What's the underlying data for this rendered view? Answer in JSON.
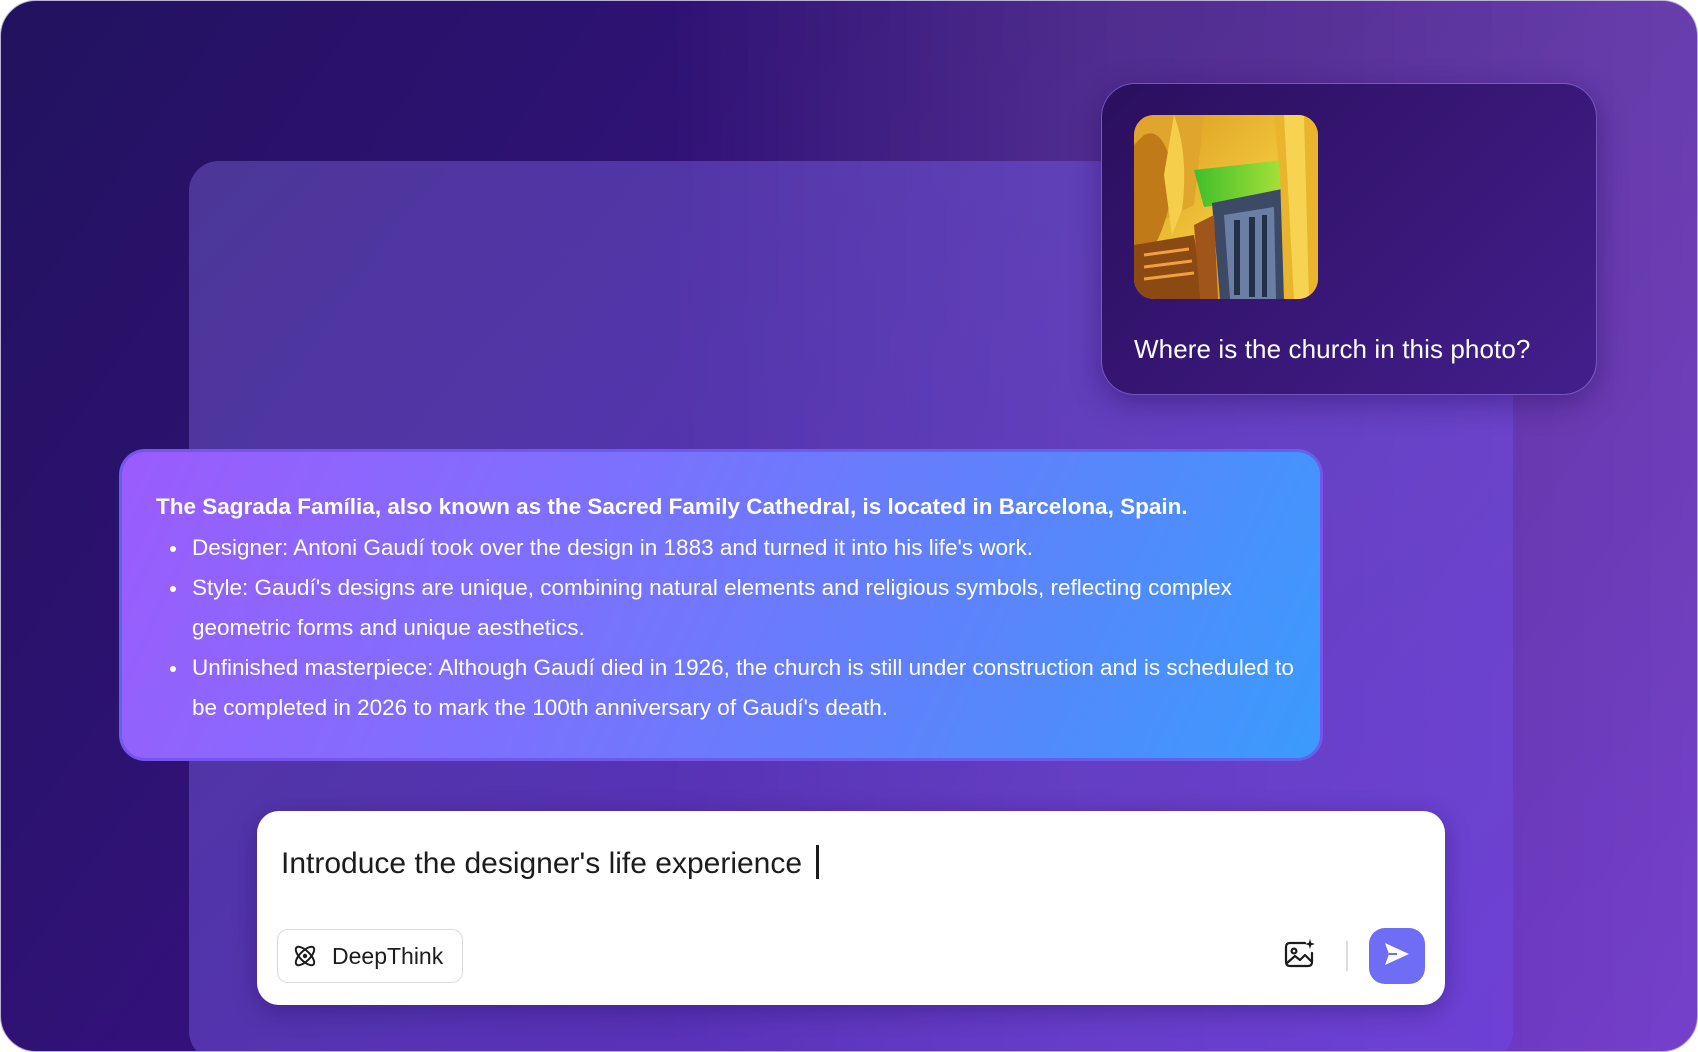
{
  "colors": {
    "background": "#2e1273",
    "answer_gradient_start": "#9b5cfd",
    "answer_gradient_end": "#3a9bfc",
    "send_button": "#6f6cf6",
    "user_card": "#2b0f5e"
  },
  "user_message": {
    "image": "photo of Sagrada Família interior with colorful stained light",
    "text": "Where is the church in this photo?"
  },
  "answer": {
    "heading": "The Sagrada Família, also known as the Sacred Family Cathedral, is located in Barcelona, Spain.",
    "bullets": [
      "Designer: Antoni Gaudí took over the design in 1883 and turned it into his life's work.",
      "Style: Gaudí's designs are unique, combining natural elements and religious symbols, reflecting complex geometric forms and unique aesthetics.",
      "Unfinished masterpiece: Although Gaudí died in 1926, the church is still under construction and is scheduled to be completed in 2026 to mark the 100th anniversary of Gaudí's death."
    ]
  },
  "composer": {
    "input_value": "Introduce the designer's life experience",
    "deepthink_label": "DeepThink",
    "deepthink_icon": "atom-icon",
    "image_upload_icon": "image-sparkle-icon",
    "send_icon": "send-icon"
  }
}
